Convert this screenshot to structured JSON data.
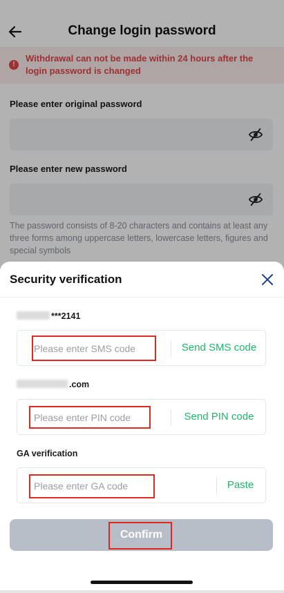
{
  "header": {
    "title": "Change login password"
  },
  "warning": {
    "text": "Withdrawal can not be made within 24 hours after the login password is changed"
  },
  "form": {
    "original_label": "Please enter original password",
    "new_label": "Please enter new password",
    "hint": "The password consists of 8-20 characters and contains at least any three forms among uppercase letters, lowercase letters, figures and special symbols"
  },
  "sheet": {
    "title": "Security verification",
    "phone_suffix": "***2141",
    "email_suffix": ".com",
    "sms": {
      "placeholder": "Please enter SMS code",
      "action": "Send SMS code"
    },
    "pin": {
      "placeholder": "Please enter PIN code",
      "action": "Send PIN code"
    },
    "ga": {
      "label": "GA verification",
      "placeholder": "Please enter GA code",
      "action": "Paste"
    },
    "confirm": "Confirm"
  },
  "colors": {
    "accent_green": "#21b56b",
    "warning_red": "#e0454a",
    "highlight_red": "#e0261f",
    "button_disabled": "#b8bec7"
  },
  "icons": [
    "back-arrow-icon",
    "warning-icon",
    "eye-off-icon",
    "close-icon"
  ]
}
